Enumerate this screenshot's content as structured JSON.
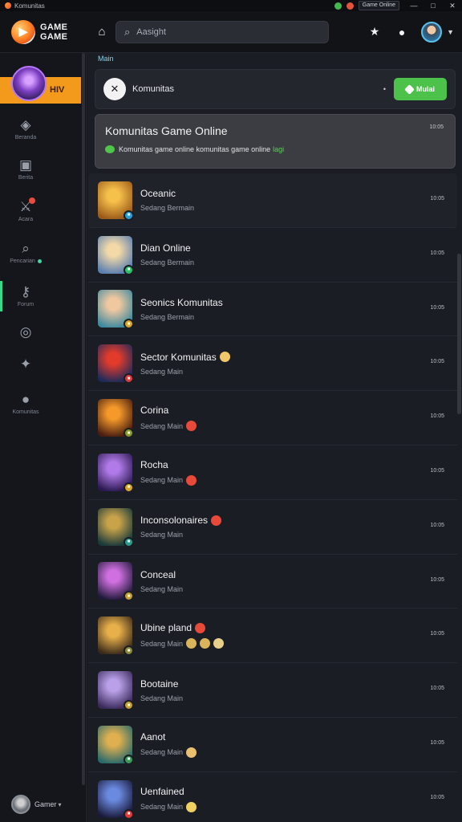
{
  "titlebar": {
    "title": "Komunitas",
    "tray_text": "Game Online",
    "controls": [
      "—",
      "□",
      "✕"
    ]
  },
  "header": {
    "logo_line1": "GAME",
    "logo_line2": "GAME",
    "search_placeholder": "Aasight"
  },
  "sidebar": {
    "active_label": "HIV",
    "items": [
      {
        "label": "Beranda"
      },
      {
        "label": "Berita"
      },
      {
        "label": "Acara"
      },
      {
        "label": "Pencarian"
      },
      {
        "label": "Forum"
      },
      {
        "label": ""
      },
      {
        "label": ""
      },
      {
        "label": "Komunitas"
      }
    ],
    "user_name": "Gamer"
  },
  "main": {
    "section_label": "Main",
    "top_card": {
      "title": "Komunitas",
      "button_label": "Mulai"
    },
    "banner": {
      "title": "Komunitas Game Online",
      "subtitle": "Komunitas game online komunitas game online",
      "link": "lagi",
      "time": "10:05"
    },
    "games": [
      {
        "name": "Oceanic",
        "sub": "Sedang Bermain",
        "time": "10:05",
        "colors": [
          "#f6c14a",
          "#9b5a1a"
        ],
        "badge": "#2a9fd6",
        "name_emoji": "",
        "sub_emojis": []
      },
      {
        "name": "Dian Online",
        "sub": "Sedang Bermain",
        "time": "10:05",
        "colors": [
          "#f3d9a8",
          "#5a7fb0"
        ],
        "badge": "#2cc06a",
        "name_emoji": "",
        "sub_emojis": []
      },
      {
        "name": "Seonics Komunitas",
        "sub": "Sedang Bermain",
        "time": "10:05",
        "colors": [
          "#f0c8a0",
          "#3f8a9e"
        ],
        "badge": "#d9a62a",
        "name_emoji": "",
        "sub_emojis": []
      },
      {
        "name": "Sector Komunitas",
        "sub": "Sedang Main",
        "time": "10:05",
        "colors": [
          "#e23b2b",
          "#1d2a5a"
        ],
        "badge": "#e03a3a",
        "name_emoji": "#f1c76a",
        "sub_emojis": []
      },
      {
        "name": "Corina",
        "sub": "Sedang Main",
        "time": "10:05",
        "colors": [
          "#f59a2a",
          "#4a1e10"
        ],
        "badge": "#8a9a2a",
        "name_emoji": "",
        "sub_emojis": [
          "#e84a3a"
        ]
      },
      {
        "name": "Rocha",
        "sub": "Sedang Main",
        "time": "10:05",
        "colors": [
          "#b07ae8",
          "#2a1850"
        ],
        "badge": "#d9a62a",
        "name_emoji": "",
        "sub_emojis": [
          "#e84a3a"
        ]
      },
      {
        "name": "Inconsolonaires",
        "sub": "Sedang Main",
        "time": "10:05",
        "colors": [
          "#c9a34a",
          "#1a3a3a"
        ],
        "badge": "#2a9a8a",
        "name_emoji": "#e84a3a",
        "sub_emojis": []
      },
      {
        "name": "Conceal",
        "sub": "Sedang Main",
        "time": "10:05",
        "colors": [
          "#d070e0",
          "#201a3a"
        ],
        "badge": "#c6a030",
        "name_emoji": "",
        "sub_emojis": []
      },
      {
        "name": "Ubine pland",
        "sub": "Sedang Main",
        "time": "10:05",
        "colors": [
          "#e8b04a",
          "#3a2a1a"
        ],
        "badge": "#8a8a3a",
        "name_emoji": "#e84a3a",
        "sub_emojis": [
          "#d9b45a",
          "#d9b45a",
          "#e8d08a"
        ]
      },
      {
        "name": "Bootaine",
        "sub": "Sedang Main",
        "time": "10:05",
        "colors": [
          "#b9a0e8",
          "#3a2a5a"
        ],
        "badge": "#c6a030",
        "name_emoji": "",
        "sub_emojis": []
      },
      {
        "name": "Aanot",
        "sub": "Sedang Main",
        "time": "10:05",
        "colors": [
          "#e0b050",
          "#2a6a6a"
        ],
        "badge": "#3a9a5a",
        "name_emoji": "",
        "sub_emojis": [
          "#e8c070"
        ]
      },
      {
        "name": "Uenfained",
        "sub": "Sedang Main",
        "time": "10:05",
        "colors": [
          "#6a8ae0",
          "#1a1a3a"
        ],
        "badge": "#e03a3a",
        "name_emoji": "",
        "sub_emojis": [
          "#f0d060"
        ]
      }
    ]
  }
}
